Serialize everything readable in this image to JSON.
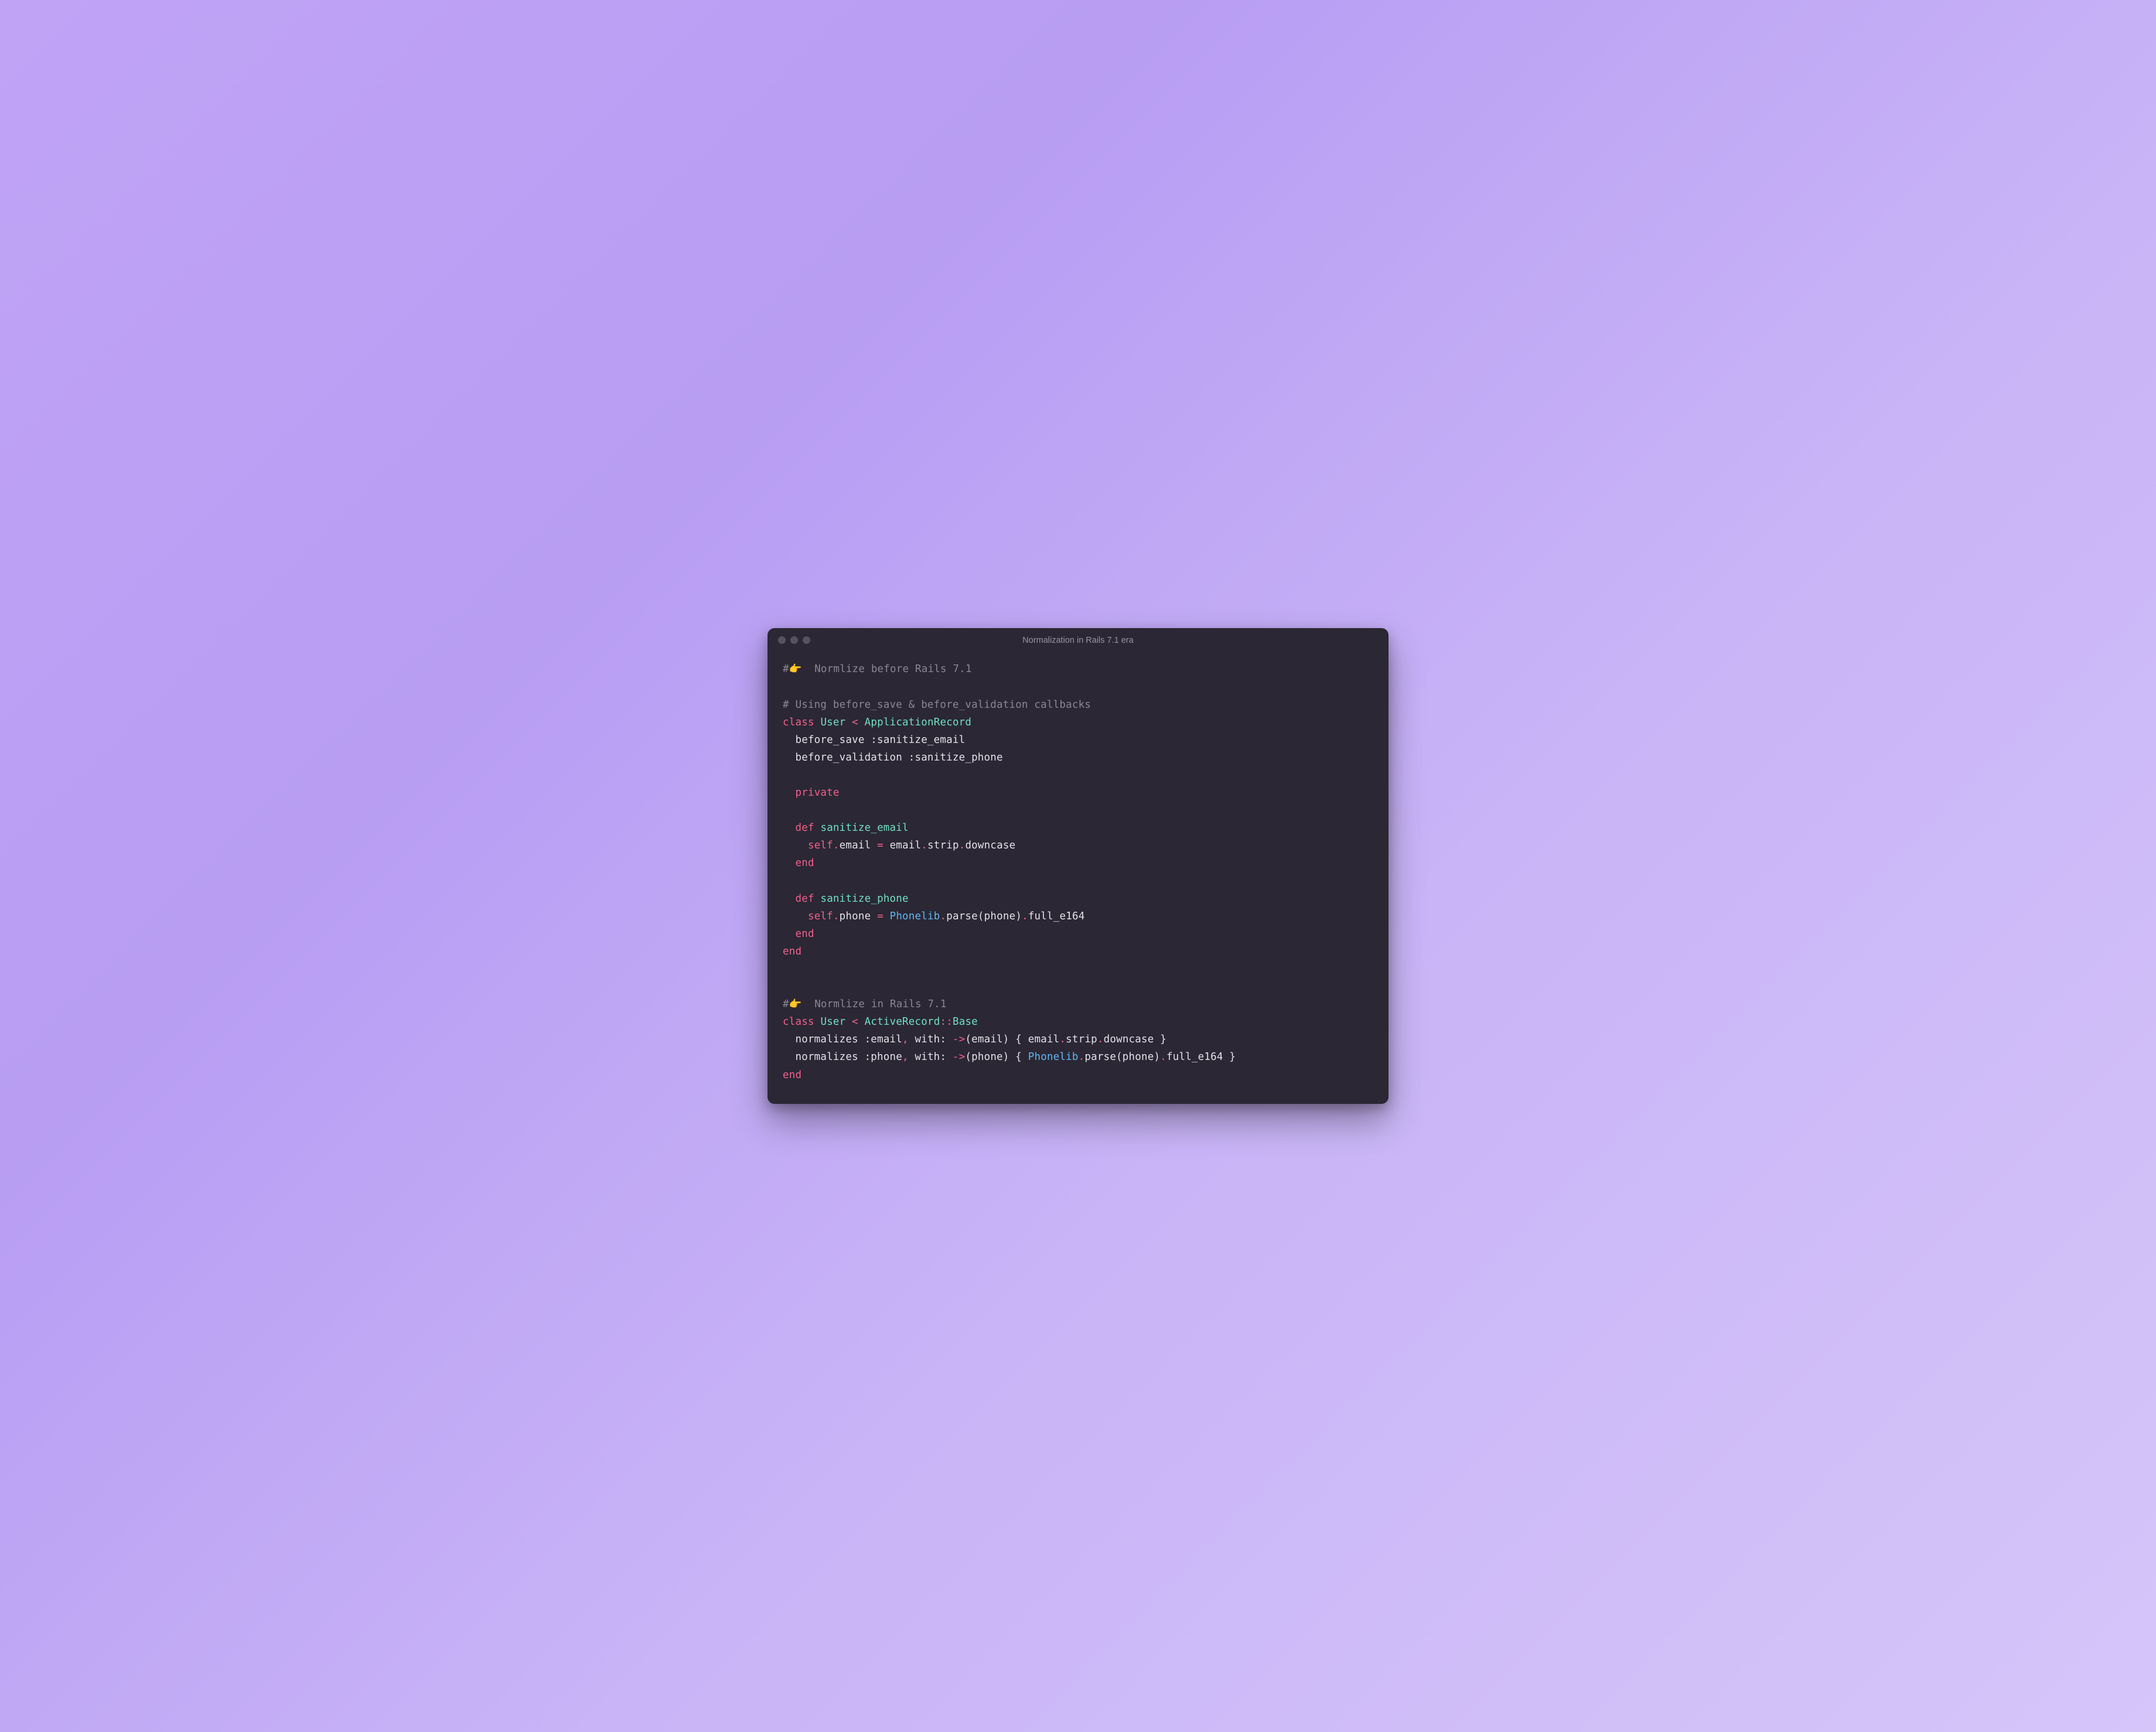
{
  "window": {
    "title": "Normalization in Rails 7.1 era"
  },
  "code": {
    "lines": [
      [
        {
          "cls": "c-comment",
          "text": "#👉  Normlize before Rails 7.1"
        }
      ],
      [],
      [
        {
          "cls": "c-comment",
          "text": "# Using before_save & before_validation callbacks"
        }
      ],
      [
        {
          "cls": "c-keyword",
          "text": "class"
        },
        {
          "cls": "c-default",
          "text": " "
        },
        {
          "cls": "c-classname",
          "text": "User"
        },
        {
          "cls": "c-default",
          "text": " "
        },
        {
          "cls": "c-punct",
          "text": "<"
        },
        {
          "cls": "c-default",
          "text": " "
        },
        {
          "cls": "c-classname",
          "text": "ApplicationRecord"
        }
      ],
      [
        {
          "cls": "c-default",
          "text": "  before_save :sanitize_email"
        }
      ],
      [
        {
          "cls": "c-default",
          "text": "  before_validation :sanitize_phone"
        }
      ],
      [],
      [
        {
          "cls": "c-default",
          "text": "  "
        },
        {
          "cls": "c-keyword",
          "text": "private"
        }
      ],
      [],
      [
        {
          "cls": "c-default",
          "text": "  "
        },
        {
          "cls": "c-keyword",
          "text": "def"
        },
        {
          "cls": "c-default",
          "text": " "
        },
        {
          "cls": "c-classname",
          "text": "sanitize_email"
        }
      ],
      [
        {
          "cls": "c-default",
          "text": "    "
        },
        {
          "cls": "c-keyword",
          "text": "self"
        },
        {
          "cls": "c-punct",
          "text": "."
        },
        {
          "cls": "c-default",
          "text": "email "
        },
        {
          "cls": "c-punct",
          "text": "="
        },
        {
          "cls": "c-default",
          "text": " email"
        },
        {
          "cls": "c-punct",
          "text": "."
        },
        {
          "cls": "c-default",
          "text": "strip"
        },
        {
          "cls": "c-punct",
          "text": "."
        },
        {
          "cls": "c-default",
          "text": "downcase"
        }
      ],
      [
        {
          "cls": "c-default",
          "text": "  "
        },
        {
          "cls": "c-keyword",
          "text": "end"
        }
      ],
      [],
      [
        {
          "cls": "c-default",
          "text": "  "
        },
        {
          "cls": "c-keyword",
          "text": "def"
        },
        {
          "cls": "c-default",
          "text": " "
        },
        {
          "cls": "c-classname",
          "text": "sanitize_phone"
        }
      ],
      [
        {
          "cls": "c-default",
          "text": "    "
        },
        {
          "cls": "c-keyword",
          "text": "self"
        },
        {
          "cls": "c-punct",
          "text": "."
        },
        {
          "cls": "c-default",
          "text": "phone "
        },
        {
          "cls": "c-punct",
          "text": "="
        },
        {
          "cls": "c-default",
          "text": " "
        },
        {
          "cls": "c-const",
          "text": "Phonelib"
        },
        {
          "cls": "c-punct",
          "text": "."
        },
        {
          "cls": "c-default",
          "text": "parse(phone)"
        },
        {
          "cls": "c-punct",
          "text": "."
        },
        {
          "cls": "c-default",
          "text": "full_e164"
        }
      ],
      [
        {
          "cls": "c-default",
          "text": "  "
        },
        {
          "cls": "c-keyword",
          "text": "end"
        }
      ],
      [
        {
          "cls": "c-keyword",
          "text": "end"
        }
      ],
      [],
      [],
      [
        {
          "cls": "c-comment",
          "text": "#👉  Normlize in Rails 7.1"
        }
      ],
      [
        {
          "cls": "c-keyword",
          "text": "class"
        },
        {
          "cls": "c-default",
          "text": " "
        },
        {
          "cls": "c-classname",
          "text": "User"
        },
        {
          "cls": "c-default",
          "text": " "
        },
        {
          "cls": "c-punct",
          "text": "<"
        },
        {
          "cls": "c-default",
          "text": " "
        },
        {
          "cls": "c-classname",
          "text": "ActiveRecord"
        },
        {
          "cls": "c-punct",
          "text": "::"
        },
        {
          "cls": "c-classname",
          "text": "Base"
        }
      ],
      [
        {
          "cls": "c-default",
          "text": "  normalizes :email"
        },
        {
          "cls": "c-punct",
          "text": ","
        },
        {
          "cls": "c-default",
          "text": " with: "
        },
        {
          "cls": "c-punct",
          "text": "->"
        },
        {
          "cls": "c-default",
          "text": "(email) { email"
        },
        {
          "cls": "c-punct",
          "text": "."
        },
        {
          "cls": "c-default",
          "text": "strip"
        },
        {
          "cls": "c-punct",
          "text": "."
        },
        {
          "cls": "c-default",
          "text": "downcase }"
        }
      ],
      [
        {
          "cls": "c-default",
          "text": "  normalizes :phone"
        },
        {
          "cls": "c-punct",
          "text": ","
        },
        {
          "cls": "c-default",
          "text": " with: "
        },
        {
          "cls": "c-punct",
          "text": "->"
        },
        {
          "cls": "c-default",
          "text": "(phone) { "
        },
        {
          "cls": "c-const",
          "text": "Phonelib"
        },
        {
          "cls": "c-punct",
          "text": "."
        },
        {
          "cls": "c-default",
          "text": "parse(phone)"
        },
        {
          "cls": "c-punct",
          "text": "."
        },
        {
          "cls": "c-default",
          "text": "full_e164 }"
        }
      ],
      [
        {
          "cls": "c-keyword",
          "text": "end"
        }
      ]
    ]
  }
}
